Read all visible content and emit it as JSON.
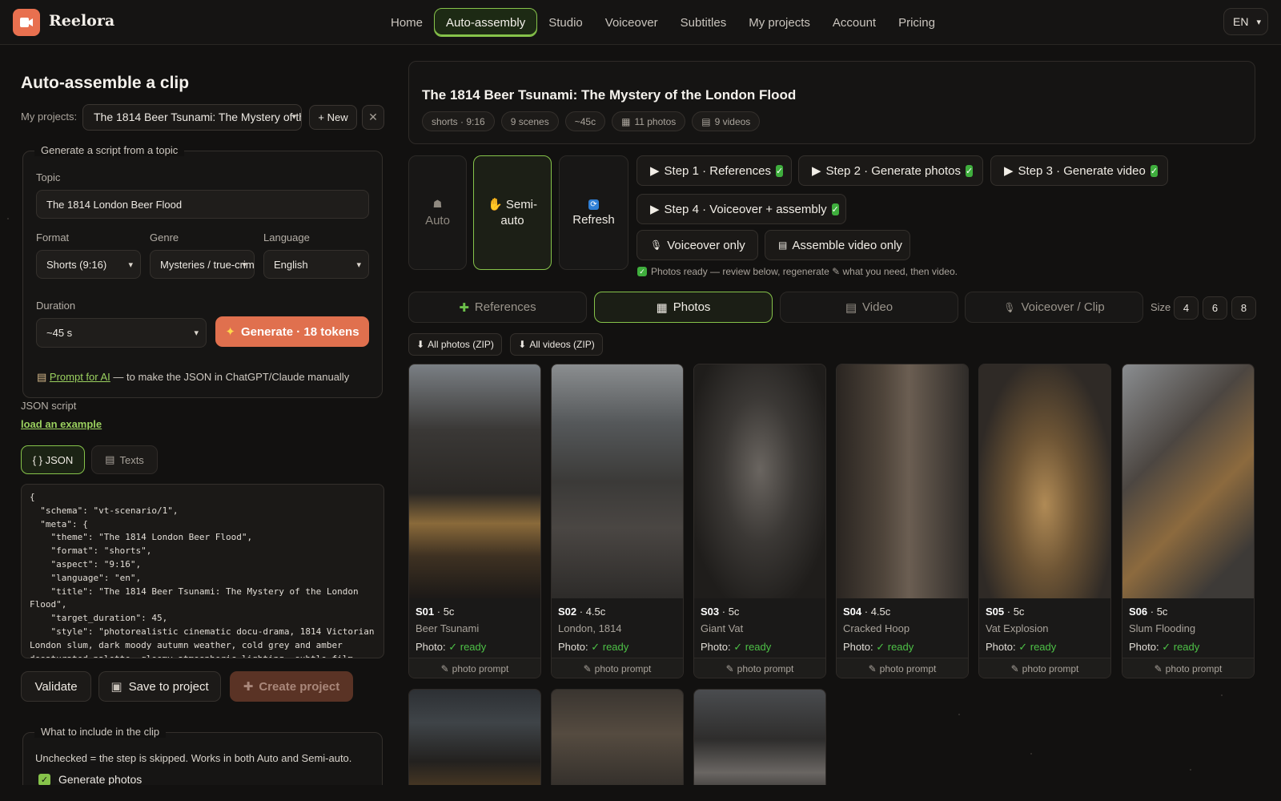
{
  "app": {
    "name": "Reelora",
    "accent": "#86c34a",
    "brand": "#e8704f"
  },
  "nav": {
    "items": [
      "Home",
      "Auto-assembly",
      "Studio",
      "Voiceover",
      "Subtitles",
      "My projects",
      "Account",
      "Pricing"
    ],
    "active": "Auto-assembly",
    "language": "EN"
  },
  "left": {
    "title": "Auto-assemble a clip",
    "projects_label": "My projects:",
    "project_selected": "The 1814 Beer Tsunami: The Mystery of the London Flood",
    "new_button": "+ New",
    "close_button": "✕",
    "generate_section": {
      "legend": "Generate a script from a topic",
      "topic_label": "Topic",
      "topic_value": "The 1814 London Beer Flood",
      "format_label": "Format",
      "format_value": "Shorts (9:16)",
      "genre_label": "Genre",
      "genre_value": "Mysteries / true-crime",
      "language_label": "Language",
      "language_value": "English",
      "duration_label": "Duration",
      "duration_value": "~45 s",
      "generate_button": "Generate · 18 tokens",
      "prompt_link": "Prompt for AI",
      "prompt_rest": " — to make the JSON in ChatGPT/Claude manually"
    },
    "json_label": "JSON script",
    "load_example": "load an example",
    "tabs": {
      "json": "{ } JSON",
      "texts": "Texts"
    },
    "code": "{\n  \"schema\": \"vt-scenario/1\",\n  \"meta\": {\n    \"theme\": \"The 1814 London Beer Flood\",\n    \"format\": \"shorts\",\n    \"aspect\": \"9:16\",\n    \"language\": \"en\",\n    \"title\": \"The 1814 Beer Tsunami: The Mystery of the London Flood\",\n    \"target_duration\": 45,\n    \"style\": \"photorealistic cinematic docu-drama, 1814 Victorian London slum, dark moody autumn weather, cold grey and amber desaturated palette, gloomy atmospheric lighting, subtle film",
    "buttons": {
      "validate": "Validate",
      "save": "Save to project",
      "create": "Create project"
    },
    "include_section": {
      "legend": "What to include in the clip",
      "description": "Unchecked = the step is skipped. Works in both Auto and Semi-auto.",
      "checkbox_label": "Generate photos",
      "checked": true
    }
  },
  "project": {
    "title": "The 1814 Beer Tsunami: The Mystery of the London Flood",
    "chips": [
      "shorts · 9:16",
      "9 scenes",
      "~45c",
      "11 photos",
      "9 videos"
    ]
  },
  "modes": {
    "auto": "Auto",
    "semi_auto": "Semi-auto",
    "refresh": "Refresh",
    "active": "Semi-auto"
  },
  "steps": [
    "Step 1 · References",
    "Step 2 · Generate photos",
    "Step 3 · Generate video",
    "Step 4 · Voiceover + assembly"
  ],
  "extra_actions": [
    "Voiceover only",
    "Assemble video only"
  ],
  "hint": "Photos ready — review below, regenerate ✎ what you need, then video.",
  "view_tabs": [
    "References",
    "Photos",
    "Video",
    "Voiceover / Clip"
  ],
  "active_view": "Photos",
  "size": {
    "label": "Size",
    "options": [
      "4",
      "6",
      "8"
    ]
  },
  "zip": {
    "photos": "All photos (ZIP)",
    "videos": "All videos (ZIP)"
  },
  "scenes": [
    {
      "id": "S01",
      "dur": "5c",
      "name": "Beer Tsunami",
      "status": "ready"
    },
    {
      "id": "S02",
      "dur": "4.5c",
      "name": "London, 1814",
      "status": "ready"
    },
    {
      "id": "S03",
      "dur": "5c",
      "name": "Giant Vat",
      "status": "ready"
    },
    {
      "id": "S04",
      "dur": "4.5c",
      "name": "Cracked Hoop",
      "status": "ready"
    },
    {
      "id": "S05",
      "dur": "5c",
      "name": "Vat Explosion",
      "status": "ready"
    },
    {
      "id": "S06",
      "dur": "5c",
      "name": "Slum Flooding",
      "status": "ready"
    }
  ],
  "scene_labels": {
    "photo": "Photo:",
    "prompt": "photo prompt"
  }
}
